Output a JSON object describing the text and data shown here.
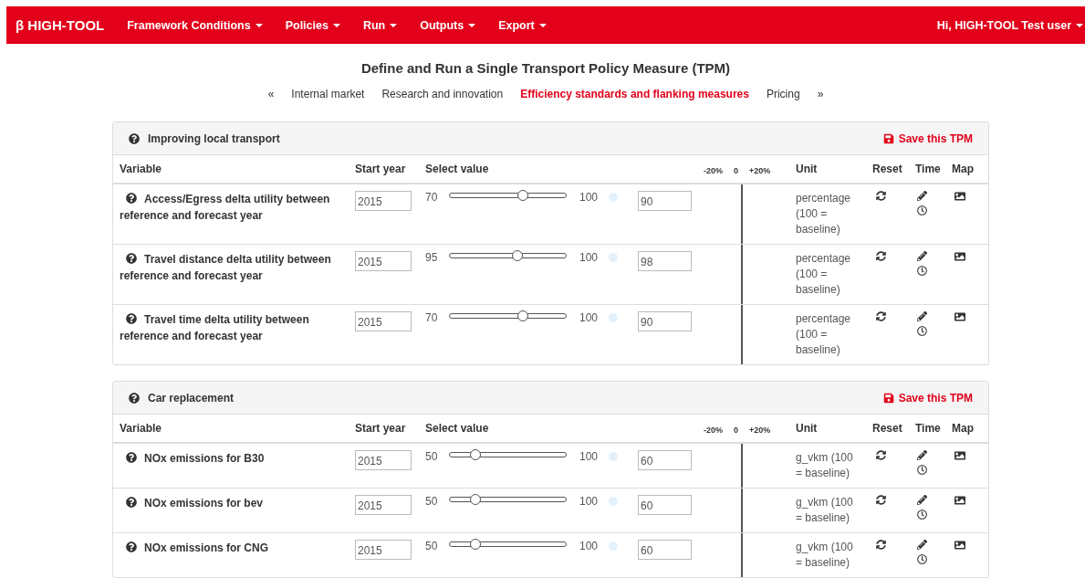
{
  "navbar": {
    "brand": "β HIGH-TOOL",
    "menus": [
      {
        "label": "Framework Conditions"
      },
      {
        "label": "Policies"
      },
      {
        "label": "Run"
      },
      {
        "label": "Outputs"
      },
      {
        "label": "Export"
      }
    ],
    "user": "Hi, HIGH-TOOL Test user"
  },
  "page_title": "Define and Run a Single Transport Policy Measure (TPM)",
  "category_tabs": {
    "prev": "«",
    "next": "»",
    "items": [
      {
        "label": "Internal market",
        "selected": false
      },
      {
        "label": "Research and innovation",
        "selected": false
      },
      {
        "label": "Efficiency standards and flanking measures",
        "selected": true
      },
      {
        "label": "Pricing",
        "selected": false
      }
    ]
  },
  "panels": [
    {
      "title": "Improving local transport",
      "save_label": "Save this TPM",
      "columns": {
        "variable": "Variable",
        "start_year": "Start year",
        "select_value": "Select value",
        "scale_low": "-20%",
        "scale_mid": "0",
        "scale_high": "+20%",
        "unit": "Unit",
        "reset": "Reset",
        "time": "Time",
        "map": "Map"
      },
      "rows": [
        {
          "name": "Access/Egress delta utility between reference and forecast year",
          "start_year": "2015",
          "min": "70",
          "level": 0.63,
          "max": "100",
          "value": "90",
          "unit": "percentage (100 = baseline)"
        },
        {
          "name": "Travel distance delta utility between reference and forecast year",
          "start_year": "2015",
          "min": "95",
          "level": 0.58,
          "max": "100",
          "value": "98",
          "unit": "percentage (100 = baseline)"
        },
        {
          "name": "Travel time delta utility between reference and forecast year",
          "start_year": "2015",
          "min": "70",
          "level": 0.63,
          "max": "100",
          "value": "90",
          "unit": "percentage (100 = baseline)"
        }
      ]
    },
    {
      "title": "Car replacement",
      "save_label": "Save this TPM",
      "columns": {
        "variable": "Variable",
        "start_year": "Start year",
        "select_value": "Select value",
        "scale_low": "-20%",
        "scale_mid": "0",
        "scale_high": "+20%",
        "unit": "Unit",
        "reset": "Reset",
        "time": "Time",
        "map": "Map"
      },
      "rows": [
        {
          "name": "NOx emissions for B30",
          "start_year": "2015",
          "min": "50",
          "level": 0.22,
          "max": "100",
          "value": "60",
          "unit": "g_vkm (100 = baseline)"
        },
        {
          "name": "NOx emissions for bev",
          "start_year": "2015",
          "min": "50",
          "level": 0.22,
          "max": "100",
          "value": "60",
          "unit": "g_vkm (100 = baseline)"
        },
        {
          "name": "NOx emissions for CNG",
          "start_year": "2015",
          "min": "50",
          "level": 0.22,
          "max": "100",
          "value": "60",
          "unit": "g_vkm (100 = baseline)"
        }
      ]
    }
  ]
}
